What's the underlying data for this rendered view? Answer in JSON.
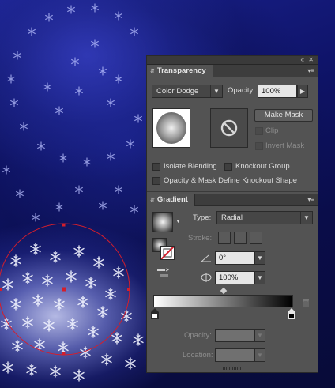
{
  "transparency": {
    "tab_label": "Transparency",
    "blend_mode": "Color Dodge",
    "opacity_label": "Opacity:",
    "opacity_value": "100%",
    "make_mask_label": "Make Mask",
    "clip_label": "Clip",
    "invert_mask_label": "Invert Mask",
    "isolate_blending_label": "Isolate Blending",
    "knockout_group_label": "Knockout Group",
    "opacity_mask_label": "Opacity & Mask Define Knockout Shape"
  },
  "gradient": {
    "tab_label": "Gradient",
    "type_label": "Type:",
    "type_value": "Radial",
    "stroke_label": "Stroke:",
    "angle_value": "0°",
    "aspect_value": "100%",
    "opacity_label": "Opacity:",
    "location_label": "Location:",
    "stops": [
      {
        "location": 0,
        "color": "#ffffff"
      },
      {
        "location": 100,
        "color": "#000000"
      }
    ]
  },
  "colors": {
    "panel_bg": "#535353",
    "selection_red": "#d41e2c"
  },
  "icons": [
    "collapse-icon",
    "close-icon",
    "panel-menu-icon",
    "no-mask-icon",
    "trash-icon",
    "reverse-gradient-icon",
    "angle-icon",
    "aspect-ratio-icon"
  ]
}
